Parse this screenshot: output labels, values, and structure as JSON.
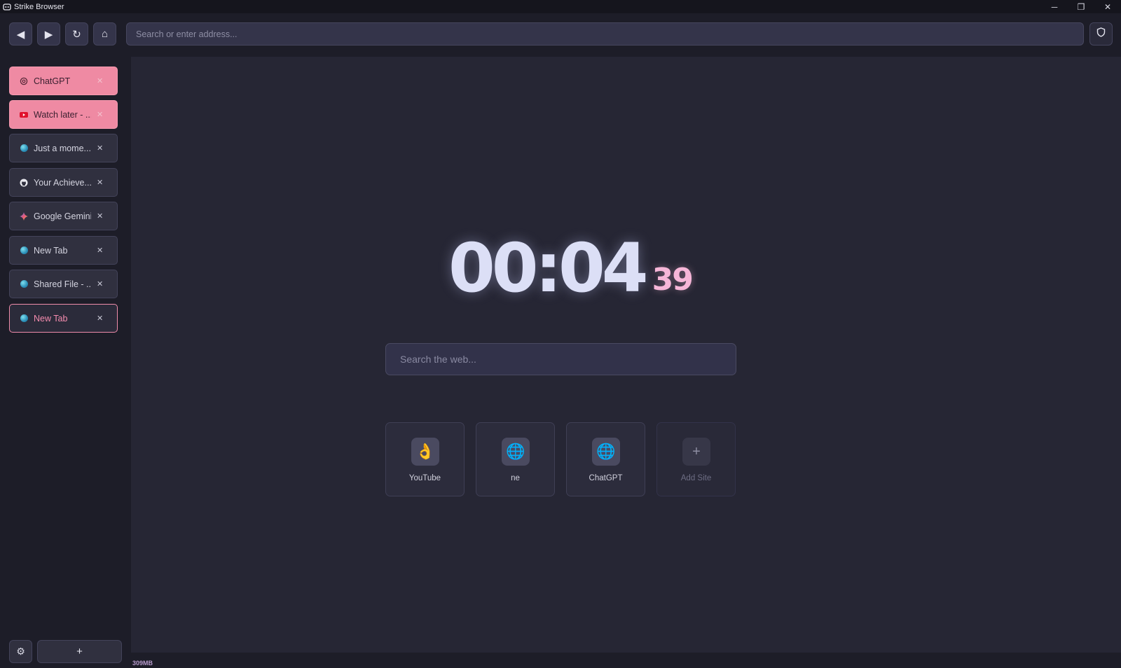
{
  "window": {
    "title": "Strike Browser",
    "controls": {
      "minimize": "─",
      "restore": "❐",
      "close": "✕"
    }
  },
  "toolbar": {
    "back": "◀",
    "forward": "▶",
    "reload": "↻",
    "home": "⌂",
    "address_placeholder": "Search or enter address..."
  },
  "tabs": [
    {
      "title": "ChatGPT",
      "icon": "chatgpt-icon",
      "state": "pinned"
    },
    {
      "title": "Watch later - ...",
      "icon": "youtube-icon",
      "state": "pinned"
    },
    {
      "title": "Just a mome...",
      "icon": "globe-icon",
      "state": "normal"
    },
    {
      "title": "Your Achieve...",
      "icon": "github-icon",
      "state": "normal"
    },
    {
      "title": "Google Gemini",
      "icon": "gemini-icon",
      "state": "normal"
    },
    {
      "title": "New Tab",
      "icon": "globe-icon",
      "state": "normal"
    },
    {
      "title": "Shared File - ...",
      "icon": "globe-icon",
      "state": "normal"
    },
    {
      "title": "New Tab",
      "icon": "globe-icon",
      "state": "active"
    }
  ],
  "tab_close": "✕",
  "sidebar_footer": {
    "settings": "⚙",
    "new_tab": "+"
  },
  "clock": {
    "hours_minutes": "00:04",
    "seconds": "39"
  },
  "search": {
    "placeholder": "Search the web..."
  },
  "shortcuts": [
    {
      "label": "YouTube",
      "icon": "ok-hand-emoji-icon",
      "glyph": "👌"
    },
    {
      "label": "ne",
      "icon": "globe-icon",
      "glyph": "🌐"
    },
    {
      "label": "ChatGPT",
      "icon": "globe-icon",
      "glyph": "🌐"
    },
    {
      "label": "Add Site",
      "icon": "plus-icon",
      "glyph": "+"
    }
  ],
  "status": {
    "memory": "309MB"
  },
  "colors": {
    "accent_pink": "#f08cab",
    "pinned_tab": "#ef8aa3",
    "clock_text": "#dcdff6",
    "clock_seconds": "#f6b6d8",
    "background": "#23232f"
  }
}
